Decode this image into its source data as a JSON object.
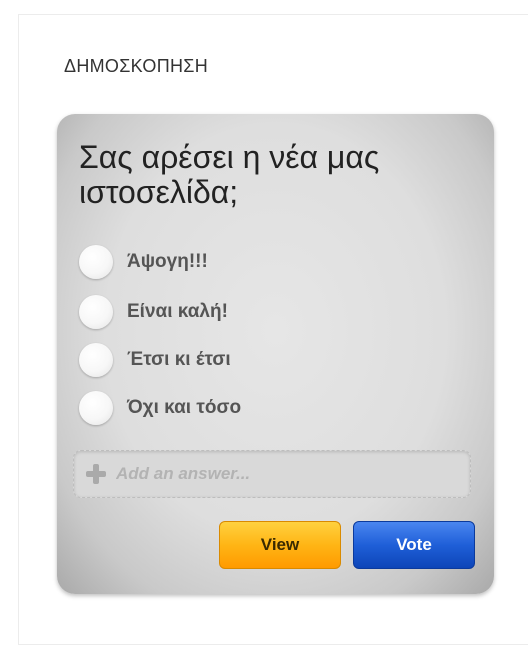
{
  "section": {
    "title": "ΔΗΜΟΣΚΟΠΗΣΗ"
  },
  "poll": {
    "question": "Σας αρέσει η νέα μας ιστοσελίδα;",
    "options": [
      {
        "label": "Άψογη!!!",
        "selected": false
      },
      {
        "label": "Είναι καλή!",
        "selected": false
      },
      {
        "label": "Έτσι κι έτσι",
        "selected": false
      },
      {
        "label": "Όχι και τόσο",
        "selected": false
      }
    ],
    "add_answer": {
      "placeholder": "Add an answer...",
      "icon": "plus-icon"
    },
    "buttons": {
      "view_label": "View",
      "vote_label": "Vote"
    }
  },
  "colors": {
    "view_button": "#ffb515",
    "vote_button": "#1f5fd8"
  }
}
